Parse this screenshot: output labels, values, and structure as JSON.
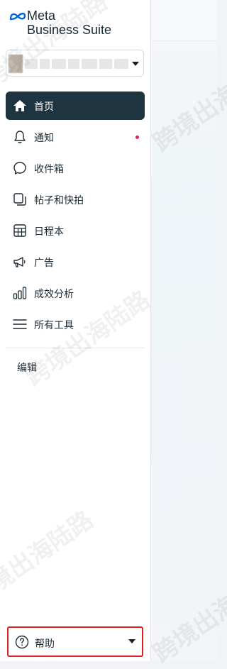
{
  "brand": {
    "line1": "Meta",
    "line2": "Business Suite"
  },
  "nav": [
    {
      "label": "首页",
      "icon": "home-icon",
      "active": true
    },
    {
      "label": "通知",
      "icon": "bell-icon",
      "badge": true
    },
    {
      "label": "收件箱",
      "icon": "chat-bubble-icon"
    },
    {
      "label": "帖子和快拍",
      "icon": "posts-icon"
    },
    {
      "label": "日程本",
      "icon": "calendar-icon"
    },
    {
      "label": "广告",
      "icon": "megaphone-icon"
    },
    {
      "label": "成效分析",
      "icon": "bar-chart-icon"
    },
    {
      "label": "所有工具",
      "icon": "menu-icon"
    }
  ],
  "edit_label": "编辑",
  "help_label": "帮助",
  "watermark": "跨境出海陆路",
  "colors": {
    "active_bg": "#1f3441",
    "badge": "#e0245e",
    "highlight_border": "#e02020"
  }
}
